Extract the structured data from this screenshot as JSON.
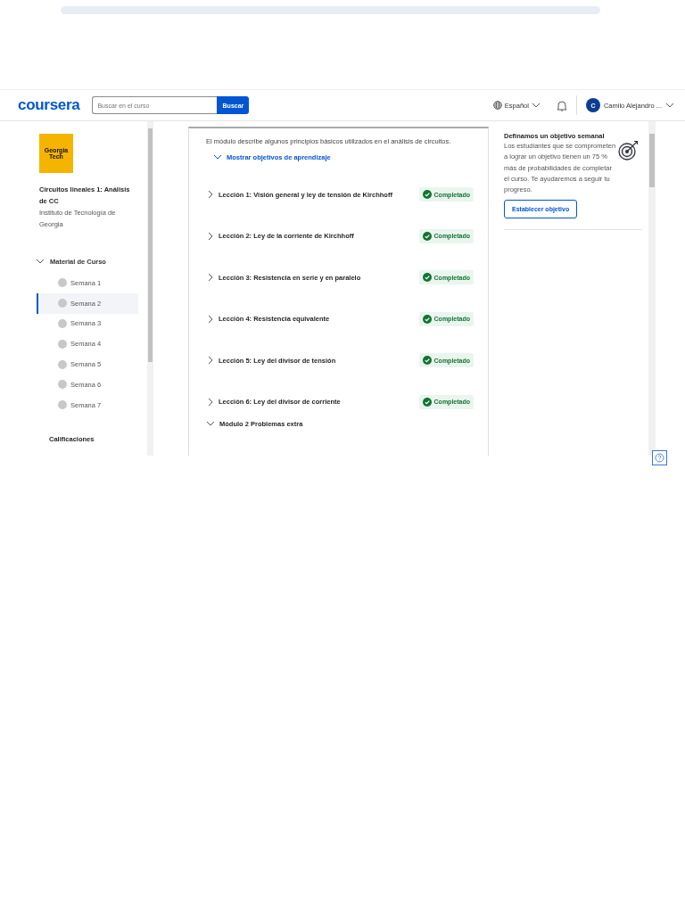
{
  "header": {
    "logo": "coursera",
    "search": {
      "placeholder": "Buscar en el curso",
      "button": "Buscar"
    },
    "language": "Español",
    "user": {
      "initial": "C",
      "name": "Camilo Alejandro ..."
    }
  },
  "sidebar": {
    "logo_lines": [
      "Georgia",
      "Tech"
    ],
    "course_title": "Circuitos lineales 1: Análisis de CC",
    "institution": "Instituto de Tecnología de Georgia",
    "section": {
      "label": "Material de Curso",
      "expanded": true,
      "children": [
        {
          "label": "Semana 1",
          "selected": false
        },
        {
          "label": "Semana 2",
          "selected": true
        },
        {
          "label": "Semana 3",
          "selected": false
        },
        {
          "label": "Semana 4",
          "selected": false
        },
        {
          "label": "Semana 5",
          "selected": false
        },
        {
          "label": "Semana 6",
          "selected": false
        },
        {
          "label": "Semana 7",
          "selected": false
        }
      ]
    },
    "grades": "Calificaciones"
  },
  "module": {
    "description": "El módulo describe algunos principios básicos utilizados en el análisis de circuitos.",
    "objectives_link": {
      "label": "Mostrar objetivos de aprendizaje",
      "expanded": false
    },
    "lessons": [
      {
        "title": "Lección 1: Visión general y ley de tensión de Kirchhoff",
        "expanded": false,
        "status": "Completado"
      },
      {
        "title": "Lección 2: Ley de la corriente de Kirchhoff",
        "expanded": false,
        "status": "Completado"
      },
      {
        "title": "Lección 3: Resistencia en serie y en paralelo",
        "expanded": false,
        "status": "Completado"
      },
      {
        "title": "Lección 4: Resistencia equivalente",
        "expanded": false,
        "status": "Completado"
      },
      {
        "title": "Lección 5: Ley del divisor de tensión",
        "expanded": false,
        "status": "Completado"
      },
      {
        "title": "Lección 6: Ley del divisor de corriente",
        "expanded": false,
        "status": "Completado"
      }
    ],
    "next_module": {
      "title": "Módulo 2 Problemas extra",
      "expanded": true
    }
  },
  "goal": {
    "title": "Definamos un objetivo semanal",
    "text": "Los estudiantes que se comprometen a lograr un objetivo tienen un 75 % más de probabilidades de completar el curso. Te ayudaremos a seguir tu progreso.",
    "button": "Establecer objetivo"
  }
}
